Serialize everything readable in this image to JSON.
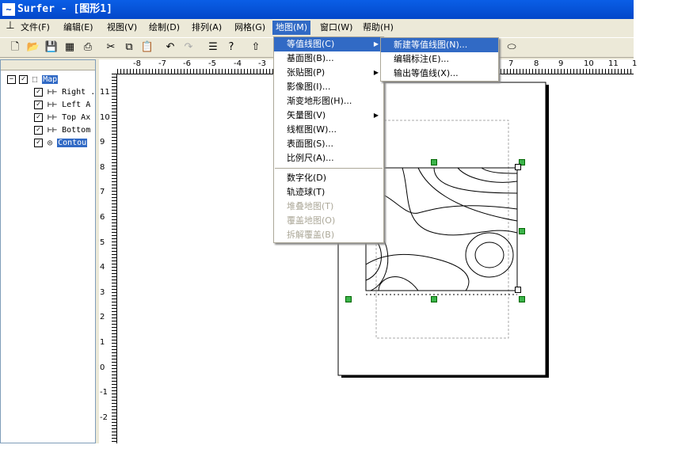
{
  "window": {
    "title": "Surfer - [图形1]",
    "app_icon": "surfer-wave-icon"
  },
  "menubar": [
    {
      "label": "文件(F)"
    },
    {
      "label": "编辑(E)"
    },
    {
      "label": "视图(V)"
    },
    {
      "label": "绘制(D)"
    },
    {
      "label": "排列(A)"
    },
    {
      "label": "网格(G)"
    },
    {
      "label": "地图(M)",
      "active": true
    },
    {
      "label": "窗口(W)"
    },
    {
      "label": "帮助(H)"
    }
  ],
  "toolbar": [
    "new-icon",
    "open-icon",
    "save-icon",
    "table-icon",
    "print-icon",
    "cut-icon",
    "copy-icon",
    "paste-icon",
    "undo-icon",
    "redo-icon",
    "object-tree-icon",
    "help-pointer-icon",
    "up-arrow-icon",
    "ellipse-icon"
  ],
  "map_menu": {
    "items": [
      {
        "label": "等值线图(C)",
        "submenu": true,
        "highlighted": true
      },
      {
        "label": "基面图(B)..."
      },
      {
        "label": "张贴图(P)",
        "submenu": true
      },
      {
        "label": "影像图(I)..."
      },
      {
        "label": "渐变地形图(H)..."
      },
      {
        "label": "矢量图(V)",
        "submenu": true
      },
      {
        "label": "线框图(W)..."
      },
      {
        "label": "表面图(S)..."
      },
      {
        "label": "比例尺(A)..."
      },
      {
        "separator": true
      },
      {
        "label": "数字化(D)"
      },
      {
        "label": "轨迹球(T)"
      },
      {
        "label": "堆叠地图(T)",
        "disabled": true
      },
      {
        "label": "覆盖地图(O)",
        "disabled": true
      },
      {
        "label": "拆解覆盖(B)",
        "disabled": true
      }
    ]
  },
  "contour_submenu": {
    "items": [
      {
        "label": "新建等值线图(N)...",
        "highlighted": true
      },
      {
        "label": "编辑标注(E)..."
      },
      {
        "label": "输出等值线(X)..."
      }
    ]
  },
  "object_tree": [
    {
      "label": "Map",
      "level": 0,
      "checked": true,
      "selected": true
    },
    {
      "label": "Right .",
      "level": 1,
      "checked": true
    },
    {
      "label": "Left A",
      "level": 1,
      "checked": true
    },
    {
      "label": "Top Ax",
      "level": 1,
      "checked": true
    },
    {
      "label": "Bottom",
      "level": 1,
      "checked": true
    },
    {
      "label": "Contou",
      "level": 1,
      "checked": true,
      "selected": true
    }
  ],
  "ruler_top": [
    "-8",
    "-7",
    "-6",
    "-5",
    "-4",
    "-3",
    "7",
    "8",
    "9",
    "10",
    "11",
    "1"
  ],
  "ruler_left": [
    "11",
    "10",
    "9",
    "8",
    "7",
    "6",
    "5",
    "4",
    "3",
    "2",
    "1",
    "0",
    "-1",
    "-2"
  ],
  "colors": {
    "titlebar": "#0347c9",
    "highlight": "#316ac5",
    "handle": "#3cb44b"
  }
}
